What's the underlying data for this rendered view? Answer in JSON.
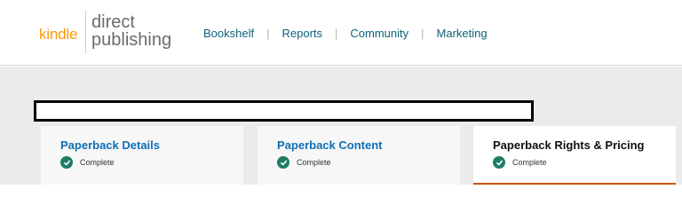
{
  "logo": {
    "kindle": "kindle",
    "direct": "direct",
    "publishing": "publishing"
  },
  "nav": {
    "items": [
      {
        "label": "Bookshelf"
      },
      {
        "label": "Reports"
      },
      {
        "label": "Community"
      },
      {
        "label": "Marketing"
      }
    ],
    "separator": "|"
  },
  "steps": [
    {
      "title": "Paperback Details",
      "status": "Complete",
      "active": false
    },
    {
      "title": "Paperback Content",
      "status": "Complete",
      "active": false
    },
    {
      "title": "Paperback Rights & Pricing",
      "status": "Complete",
      "active": true
    }
  ],
  "colors": {
    "brand_orange": "#ff9900",
    "link": "#0e6178",
    "step_link": "#0e6fb3",
    "complete_green": "#1d7d64",
    "active_underline": "#c45500"
  },
  "icons": {
    "status_icon": "check-circle-icon"
  }
}
